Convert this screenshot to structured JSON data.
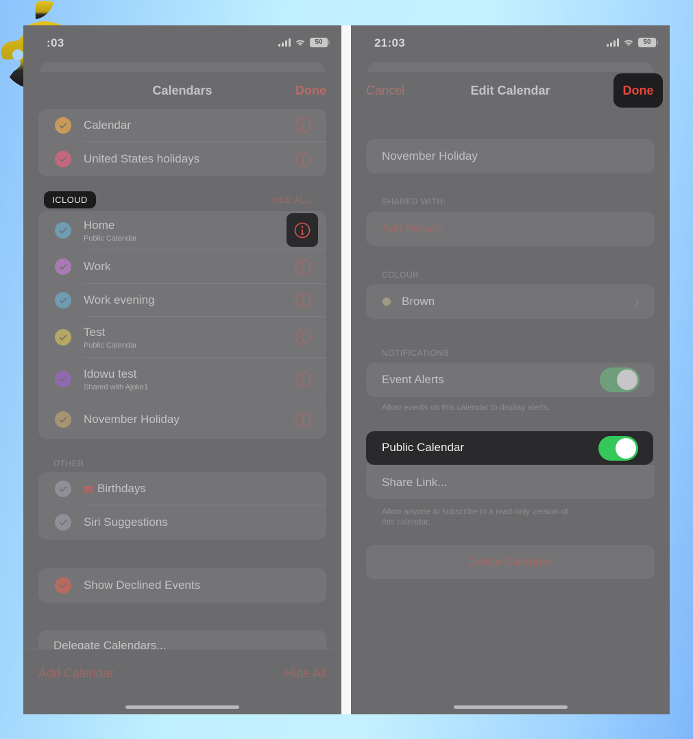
{
  "left_screen": {
    "status_bar": {
      "time": ":03",
      "battery": "50"
    },
    "navbar": {
      "title": "Calendars",
      "done": "Done"
    },
    "top_group": [
      {
        "title": "Calendar",
        "color": "#c89a5a"
      },
      {
        "title": "United States holidays",
        "color": "#c4687e"
      }
    ],
    "icloud_section": {
      "label": "ICLOUD",
      "action": "HIDE ALL",
      "items": [
        {
          "title": "Home",
          "subtitle": "Public Calendar",
          "color": "#6f9cb0"
        },
        {
          "title": "Work",
          "subtitle": "",
          "color": "#a879b2"
        },
        {
          "title": "Work evening",
          "subtitle": "",
          "color": "#6f9cb0"
        },
        {
          "title": "Test",
          "subtitle": "Public Calendar",
          "color": "#b7a764"
        },
        {
          "title": "Idowu test",
          "subtitle": "Shared with Ajoke1",
          "color": "#9169b0"
        },
        {
          "title": "November Holiday",
          "subtitle": "",
          "color": "#a89372"
        }
      ]
    },
    "other_section": {
      "label": "OTHER",
      "items": [
        {
          "title": "Birthdays",
          "icon": "gift-icon",
          "color": "#8e9099"
        },
        {
          "title": "Siri Suggestions",
          "color": "#8e9099"
        }
      ]
    },
    "show_declined": {
      "title": "Show Declined Events",
      "color": "#b86a60"
    },
    "delegate": "Delegate Calendars...",
    "bottom_bar": {
      "add_calendar": "Add Calendar",
      "hide_all": "Hide All"
    }
  },
  "right_screen": {
    "status_bar": {
      "time": "21:03",
      "battery": "50"
    },
    "navbar": {
      "cancel": "Cancel",
      "title": "Edit Calendar",
      "done": "Done"
    },
    "name_field": {
      "value": "November Holiday"
    },
    "shared_with": {
      "label": "SHARED WITH:",
      "add_person": "Add Person"
    },
    "colour": {
      "label": "COLOUR",
      "value": "Brown",
      "swatch": "#a39a84"
    },
    "notifications": {
      "label": "NOTIFICATIONS",
      "event_alerts": "Event Alerts",
      "event_alerts_on": true,
      "event_alerts_footnote": "Allow events on this calendar to display alerts."
    },
    "public_calendar": {
      "label": "Public Calendar",
      "on": true,
      "share_link": "Share Link...",
      "footnote_line1": "Allow anyone to subscribe to a read-only version of",
      "footnote_line2": "this calendar."
    },
    "delete": "Delete Calendar"
  },
  "colors": {
    "accent_red": "#e8453c",
    "toggle_green": "#34c759",
    "dimmed_toggle_green": "#6e9f7a"
  }
}
